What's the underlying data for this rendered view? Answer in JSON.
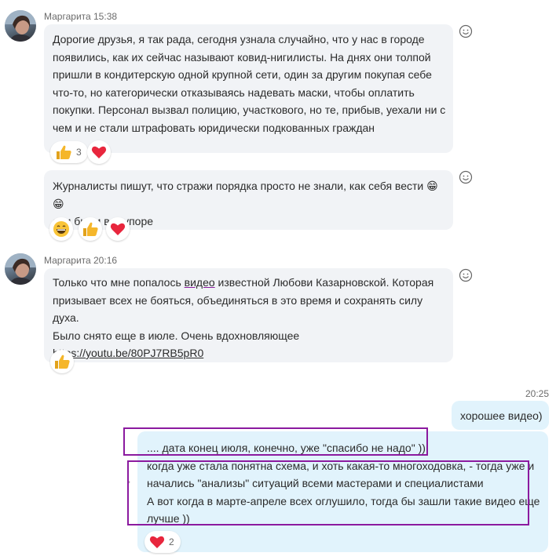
{
  "messages": [
    {
      "sender": "Маргарита 15:38",
      "lines": [
        "Дорогие друзья, я так рада, сегодня узнала случайно, что у нас в городе",
        "появились, как их сейчас называют ковид-нигилисты. На днях они толпой",
        "пришли в кондитерскую одной крупной сети, один за другим покупая себе",
        "что-то, но категорически отказываясь надевать маски, чтобы оплатить",
        "покупки. Персонал вызвал полицию, участкового, но те, прибыв, уехали ни с",
        "чем и не стали штрафовать юридически подкованных граждан"
      ],
      "reactions": [
        {
          "icon": "thumbs-up",
          "count": "3"
        },
        {
          "icon": "heart",
          "count": ""
        }
      ]
    },
    {
      "sender": "",
      "lines": [
        "Журналисты пишут, что стражи порядка просто не знали, как себя вести 😁😁",
        "они были в ступоре"
      ],
      "reactions": [
        {
          "icon": "grin",
          "count": ""
        },
        {
          "icon": "thumbs-up",
          "count": ""
        },
        {
          "icon": "heart",
          "count": ""
        }
      ]
    },
    {
      "sender": "Маргарита 20:16",
      "line1_before": "Только что мне попалось ",
      "line1_link": "видео",
      "line1_after": " известной Любови Казарновской. Которая",
      "lines": [
        "призывает всех не бояться, объединяться в это время и сохранять силу духа.",
        "Было снято еще в июле. Очень вдохновляющее"
      ],
      "url": "https://youtu.be/80PJ7RB5pR0",
      "reactions": [
        {
          "icon": "thumbs-up",
          "count": ""
        }
      ]
    }
  ],
  "outgoing": {
    "time": "20:25",
    "text": "хорошее видео)"
  },
  "quoted_reply": {
    "lines": [
      ".... дата конец июля, конечно, уже \"спасибо не надо\" ))",
      "когда уже стала понятна схема, и хоть какая-то многоходовка, - тогда уже и",
      "начались \"анализы\" ситуаций всеми мастерами и специалистами",
      "А вот когда в марте-апреле всех оглушило, тогда бы зашли такие видео еще",
      "лучше ))"
    ],
    "reaction": {
      "icon": "heart",
      "count": "2"
    }
  },
  "colors": {
    "incoming_bubble": "#f1f3f6",
    "outgoing_bubble": "#e1f3fc",
    "highlight": "#8b1a9f",
    "heart": "#e8263d",
    "thumbs": "#f5b62a"
  }
}
